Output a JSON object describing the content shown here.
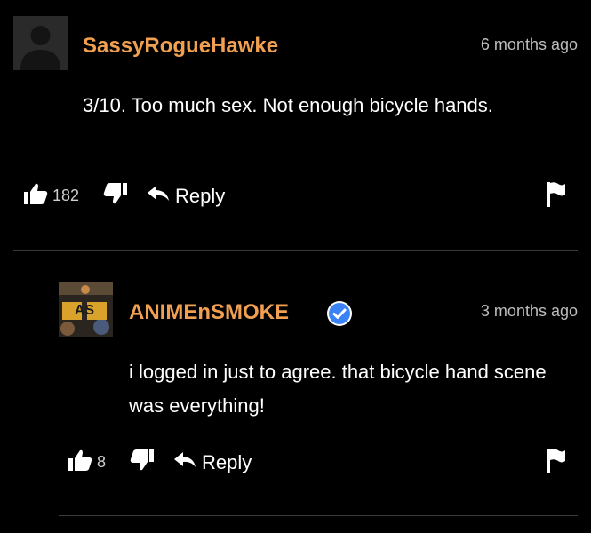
{
  "comments": [
    {
      "username": "SassyRogueHawke",
      "time": "6 months ago",
      "text": "3/10. Too much sex. Not enough bicycle hands.",
      "likes": "182",
      "reply_label": "Reply",
      "avatar_icon": "default-avatar-icon"
    },
    {
      "username": "ANIMEnSMOKE",
      "verified_icon": "verified-badge-icon",
      "time": "3 months ago",
      "text": "i logged in just to agree. that bicycle hand scene was everything!",
      "likes": "8",
      "reply_label": "Reply",
      "avatar_icon": "anime-smoke-avatar",
      "avatar_text": "AS"
    }
  ],
  "colors": {
    "background": "#000000",
    "username": "#f0a050",
    "text": "#ffffff",
    "meta": "#bdbdbd",
    "verified": "#3b82f6"
  },
  "icons": [
    "thumbs-up-icon",
    "thumbs-down-icon",
    "reply-arrow-icon",
    "flag-icon"
  ]
}
